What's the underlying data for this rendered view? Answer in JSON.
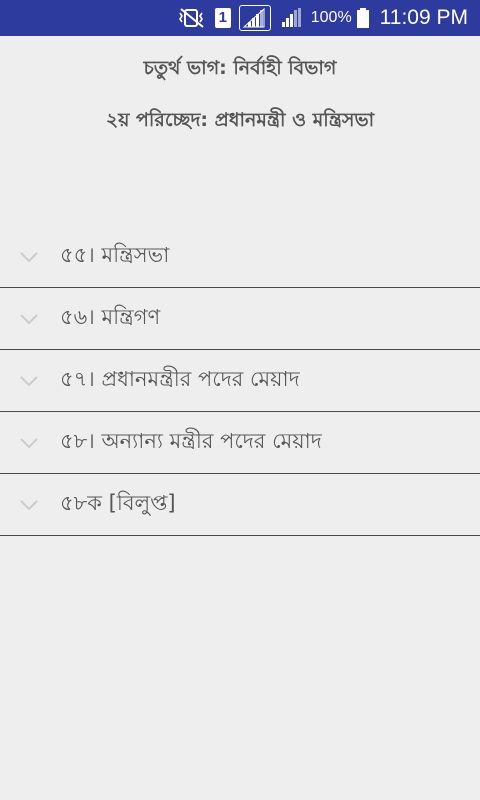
{
  "status_bar": {
    "sim_slot": "1",
    "battery_percent": "100%",
    "time": "11:09 PM"
  },
  "header": {
    "part_title": "চতুর্থ ভাগ:  নির্বাহী বিভাগ",
    "chapter_title": "২য় পরিচ্ছেদ: প্রধানমন্ত্রী ও মন্ত্রিসভা"
  },
  "articles": [
    {
      "label": "৫৫। মন্ত্রিসভা"
    },
    {
      "label": "৫৬। মন্ত্রিগণ"
    },
    {
      "label": "৫৭। প্রধানমন্ত্রীর পদের মেয়াদ"
    },
    {
      "label": "৫৮। অন্যান্য মন্ত্রীর পদের মেয়াদ"
    },
    {
      "label": "৫৮ক [বিলুপ্ত]"
    }
  ],
  "colors": {
    "status_bar": "#2d3a9e",
    "background": "#eeeeee",
    "text": "#555555",
    "divider": "#4a4a4a",
    "chevron": "#cccccc"
  },
  "icons": {
    "status": [
      "mute-vibrate-icon",
      "sim-1-icon",
      "signal-strength-icon",
      "signal-strength-2-icon",
      "battery-full-icon"
    ],
    "row": "chevron-down-icon"
  }
}
